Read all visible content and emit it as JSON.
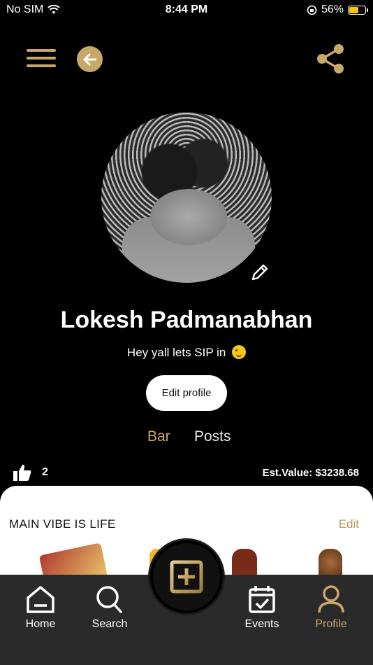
{
  "status_bar": {
    "carrier": "No SIM",
    "time": "8:44 PM",
    "battery": "56%"
  },
  "top_nav": {
    "menu_icon": "hamburger-icon",
    "back_icon": "arrow-left-icon",
    "share_icon": "share-icon"
  },
  "profile": {
    "name": "Lokesh Padmanabhan",
    "bio": "Hey yall lets SIP in",
    "edit_profile_label": "Edit profile"
  },
  "tabs": [
    {
      "label": "Bar",
      "active": true
    },
    {
      "label": "Posts",
      "active": false
    }
  ],
  "stats": {
    "likes_count": "2",
    "est_value": "Est.Value: $3238.68"
  },
  "collection": {
    "title": "MAIN VIBE IS LIFE",
    "edit_label": "Edit"
  },
  "bottom_nav": {
    "items": [
      {
        "label": "Home",
        "icon": "home-icon"
      },
      {
        "label": "Search",
        "icon": "search-icon"
      },
      {
        "label": "Events",
        "icon": "calendar-check-icon"
      },
      {
        "label": "Profile",
        "icon": "user-icon",
        "active": true
      }
    ],
    "fab_icon": "plus-square-icon"
  },
  "colors": {
    "accent": "#c8a869",
    "background": "#000000",
    "card": "#ffffff",
    "nav": "#2a2a2a"
  }
}
